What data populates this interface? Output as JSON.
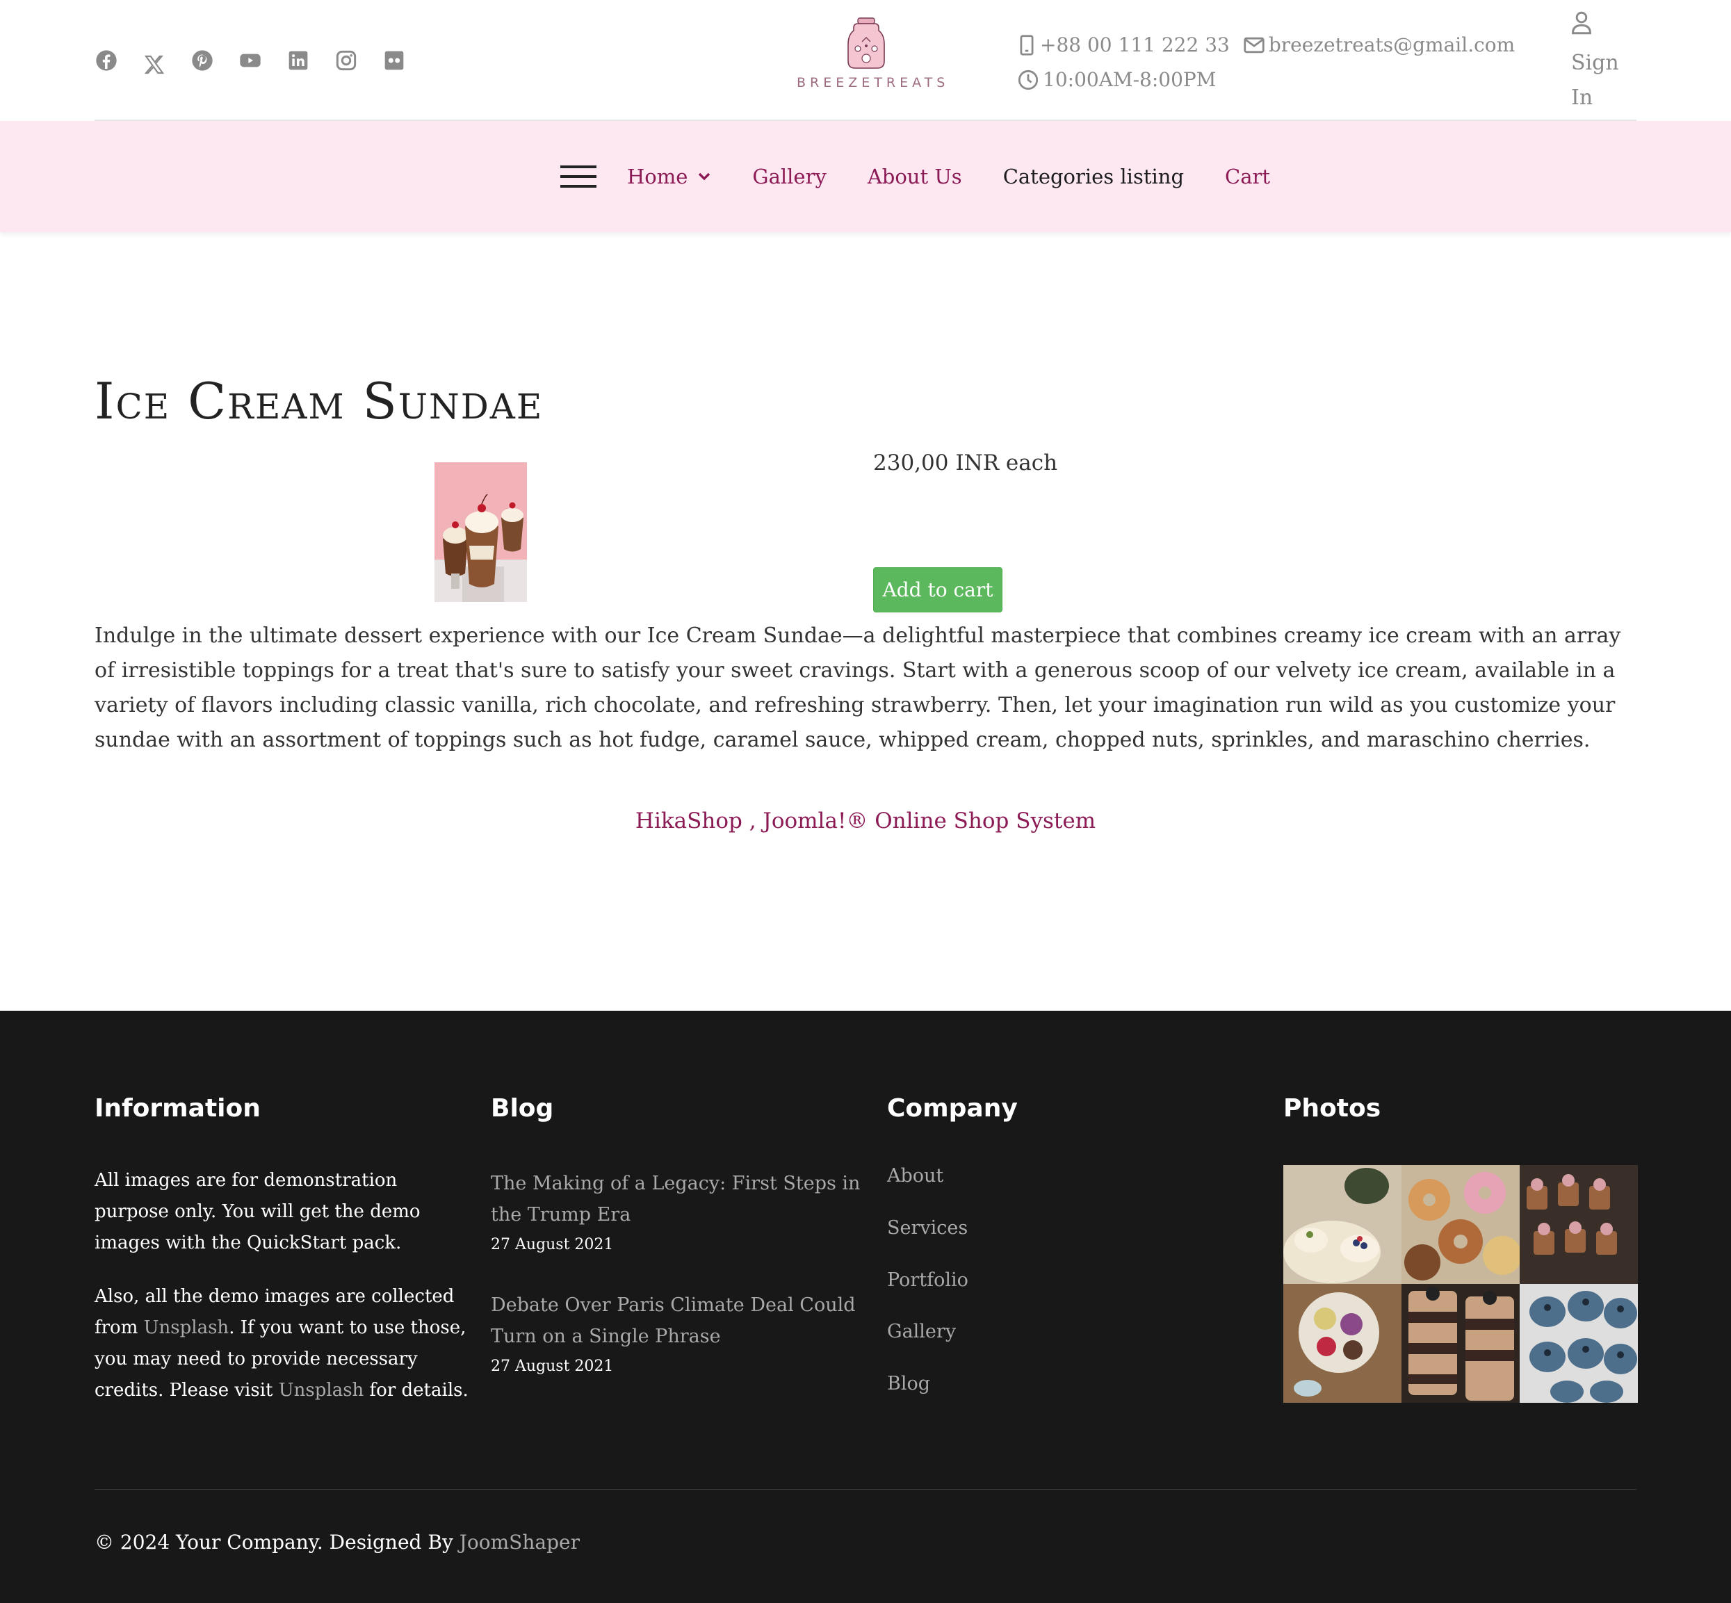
{
  "header": {
    "socials": [
      "facebook-icon",
      "x-twitter-icon",
      "pinterest-icon",
      "youtube-icon",
      "linkedin-icon",
      "instagram-icon",
      "flickr-icon"
    ],
    "logo_text": "BREEZETREATS",
    "phone": "+88 00 111 222 33",
    "email": "breezetreats@gmail.com",
    "hours": "10:00AM-8:00PM",
    "signin_line1": "Sign",
    "signin_line2": "In"
  },
  "nav": {
    "items": [
      {
        "label": "Home",
        "has_dropdown": true
      },
      {
        "label": "Gallery"
      },
      {
        "label": "About Us"
      },
      {
        "label": "Categories listing"
      },
      {
        "label": "Cart"
      }
    ]
  },
  "product": {
    "title": "Ice Cream Sundae",
    "price": "230,00 INR each",
    "add_to_cart_label": "Add to cart",
    "description": "Indulge in the ultimate dessert experience with our Ice Cream Sundae—a delightful masterpiece that combines creamy ice cream with an array of irresistible toppings for a treat that's sure to satisfy your sweet cravings. Start with a generous scoop of our velvety ice cream, available in a variety of flavors including classic vanilla, rich chocolate, and refreshing strawberry. Then, let your imagination run wild as you customize your sundae with an assortment of toppings such as hot fudge, caramel sauce, whipped cream, chopped nuts, sprinkles, and maraschino cherries.",
    "powered_by": "HikaShop , Joomla!® Online Shop System"
  },
  "footer": {
    "information": {
      "heading": "Information",
      "p1": "All images are for demonstration purpose only. You will get the demo images with the QuickStart pack.",
      "p2_a": "Also, all the demo images are collected from ",
      "p2_link1": "Unsplash",
      "p2_b": ". If you want to use those, you may need to provide necessary credits. Please visit ",
      "p2_link2": "Unsplash",
      "p2_c": " for details."
    },
    "blog": {
      "heading": "Blog",
      "posts": [
        {
          "title": "The Making of a Legacy: First Steps in the Trump Era",
          "date": "27 August 2021"
        },
        {
          "title": "Debate Over Paris Climate Deal Could Turn on a Single Phrase",
          "date": "27 August 2021"
        }
      ]
    },
    "company": {
      "heading": "Company",
      "links": [
        "About",
        "Services",
        "Portfolio",
        "Gallery",
        "Blog"
      ]
    },
    "photos": {
      "heading": "Photos"
    },
    "copyright_text": "© 2024 Your Company. Designed By ",
    "copyright_link": "JoomShaper"
  },
  "colors": {
    "accent": "#8b1a55",
    "nav_bg": "#fde8f2",
    "button": "#5cb85c",
    "footer_bg": "#181818",
    "muted": "#8a8a8a"
  }
}
